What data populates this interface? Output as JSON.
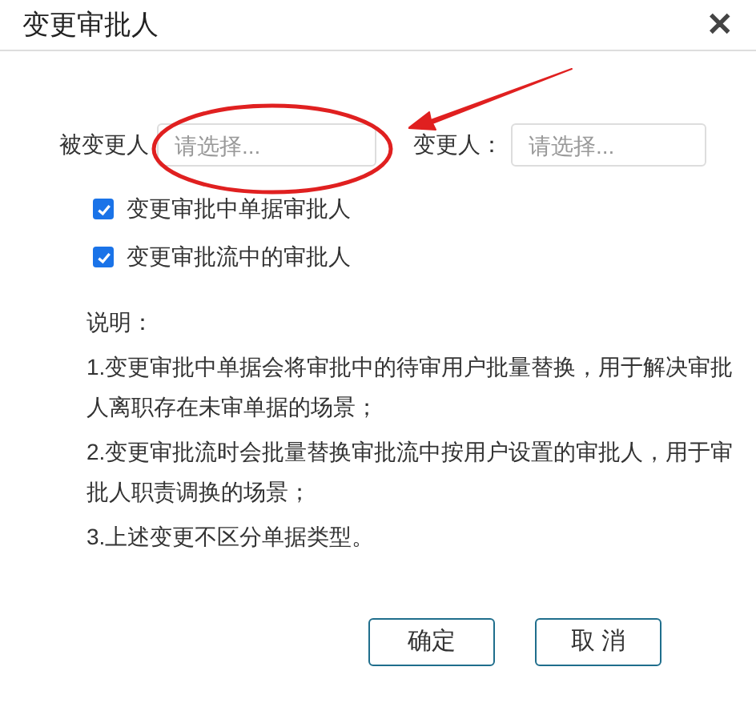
{
  "dialog": {
    "title": "变更审批人",
    "close": "✕"
  },
  "fields": [
    {
      "label": "被变更人",
      "placeholder": "请选择..."
    },
    {
      "label": "变更人：",
      "placeholder": "请选择..."
    }
  ],
  "options": [
    {
      "label": "变更审批中单据审批人",
      "checked": true
    },
    {
      "label": "变更审批流中的审批人",
      "checked": true
    }
  ],
  "notes": {
    "heading": "说明：",
    "items": [
      "1.变更审批中单据会将审批中的待审用户批量替换，用于解决审批人离职存在未审单据的场景；",
      "2.变更审批流时会批量替换审批流中按用户设置的审批人，用于审批人职责调换的场景；",
      "3.上述变更不区分单据类型。"
    ]
  },
  "buttons": [
    "确定",
    "取 消"
  ]
}
